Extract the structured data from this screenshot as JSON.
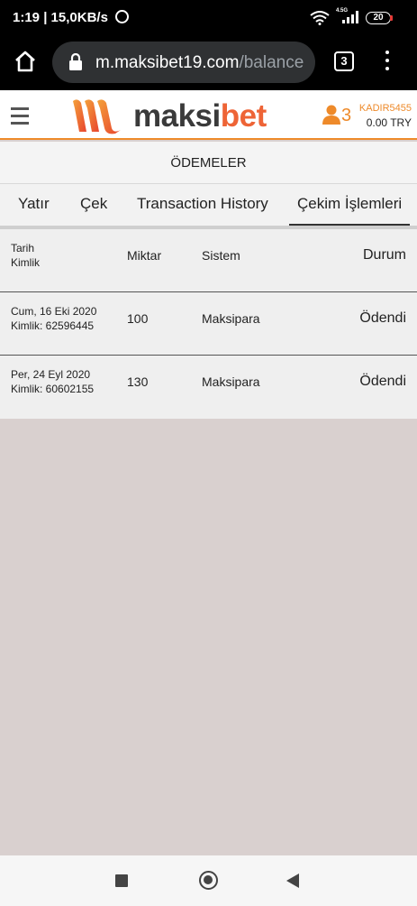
{
  "status_bar": {
    "time": "1:19 | 15,0KB/s",
    "network": "4.5G",
    "battery": "20"
  },
  "browser": {
    "url_main": "m.maksibet19.com",
    "url_rest": "/balance",
    "tab_count": "3"
  },
  "header": {
    "logo_dark": "maksi",
    "logo_orange": "bet",
    "user_count": "3",
    "username": "KADIR5455",
    "balance": "0.00 TRY"
  },
  "page_title": "ÖDEMELER",
  "tabs": [
    {
      "label": "Yatır"
    },
    {
      "label": "Çek"
    },
    {
      "label": "Transaction History"
    },
    {
      "label": "Çekim İşlemleri",
      "active": true
    }
  ],
  "table": {
    "headers": {
      "date": "Tarih",
      "id": "Kimlik",
      "amount": "Miktar",
      "system": "Sistem",
      "status": "Durum"
    },
    "rows": [
      {
        "date": "Cum, 16 Eki 2020",
        "id": "Kimlik: 62596445",
        "amount": "100",
        "system": "Maksipara",
        "status": "Ödendi"
      },
      {
        "date": "Per, 24 Eyl 2020",
        "id": "Kimlik: 60602155",
        "amount": "130",
        "system": "Maksipara",
        "status": "Ödendi"
      }
    ]
  },
  "colors": {
    "accent": "#ee8a2a",
    "brand": "#ee6436",
    "background": "#d9d0cf"
  }
}
